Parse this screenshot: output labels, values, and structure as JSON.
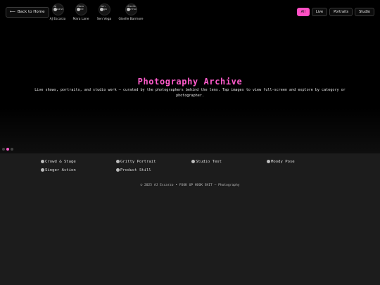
{
  "nav": {
    "back_label": "Back to Home",
    "back_icon": "arrow-left-icon"
  },
  "photographers": [
    {
      "name": "AJ Escarzo",
      "alt": "AJ Escarzo"
    },
    {
      "name": "Mara Lane",
      "alt": "Mara Lane"
    },
    {
      "name": "Sen Vega",
      "alt": "Sen Vega"
    },
    {
      "name": "Giselle Barmore",
      "alt": "Giselle Barmore"
    }
  ],
  "filters": [
    "All",
    "Live",
    "Portraits",
    "Studio"
  ],
  "active_filter": "All",
  "hero": {
    "title": "Photography Archive",
    "description": "Live shows, portraits, and studio work — curated by the photographers behind the lens. Tap images to view full-screen and explore by category or photographer."
  },
  "gallery": [
    "Crowd & Stage",
    "Gritty Portrait",
    "Studio Test",
    "Moody Pose",
    "Singer Action",
    "Product Still"
  ],
  "footer": "© 2025 AJ Escarzo • FOOK UP HOOK SHIT — Photography",
  "colors": {
    "accent": "#ff5ccc",
    "background": "#1c1c1c",
    "hero": "#000000"
  }
}
